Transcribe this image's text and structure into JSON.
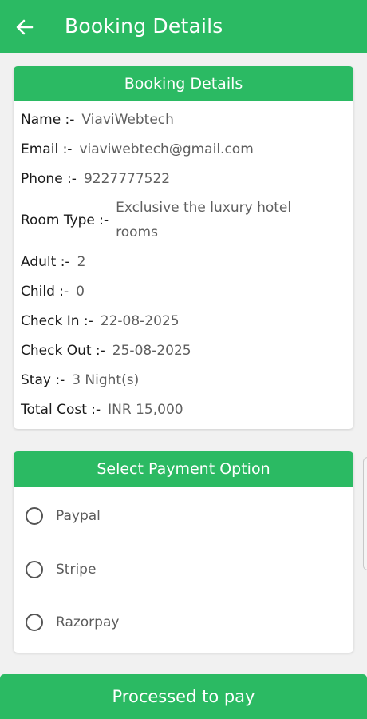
{
  "appbar": {
    "title": "Booking Details",
    "back_icon": "arrow-left-icon"
  },
  "booking": {
    "header": "Booking Details",
    "rows": [
      {
        "label": "Name :-",
        "value": "ViaviWebtech"
      },
      {
        "label": "Email :-",
        "value": "viaviwebtech@gmail.com"
      },
      {
        "label": "Phone :-",
        "value": "9227777522"
      },
      {
        "label": "Room Type :-",
        "value": "Exclusive the luxury hotel rooms"
      },
      {
        "label": "Adult :-",
        "value": "2"
      },
      {
        "label": "Child :-",
        "value": "0"
      },
      {
        "label": "Check In :-",
        "value": "22-08-2025"
      },
      {
        "label": "Check Out :-",
        "value": "25-08-2025"
      },
      {
        "label": "Stay :-",
        "value": "3 Night(s)"
      },
      {
        "label": "Total Cost :-",
        "value": "INR 15,000"
      }
    ]
  },
  "payment": {
    "header": "Select Payment Option",
    "options": [
      {
        "label": "Paypal",
        "selected": false
      },
      {
        "label": "Stripe",
        "selected": false
      },
      {
        "label": "Razorpay",
        "selected": false
      }
    ]
  },
  "pay_button": {
    "label": "Processed to pay"
  },
  "colors": {
    "primary": "#2bba63",
    "background": "#f1f1f1",
    "label_text": "#1b1b1b",
    "value_text": "#5f5f5f"
  }
}
